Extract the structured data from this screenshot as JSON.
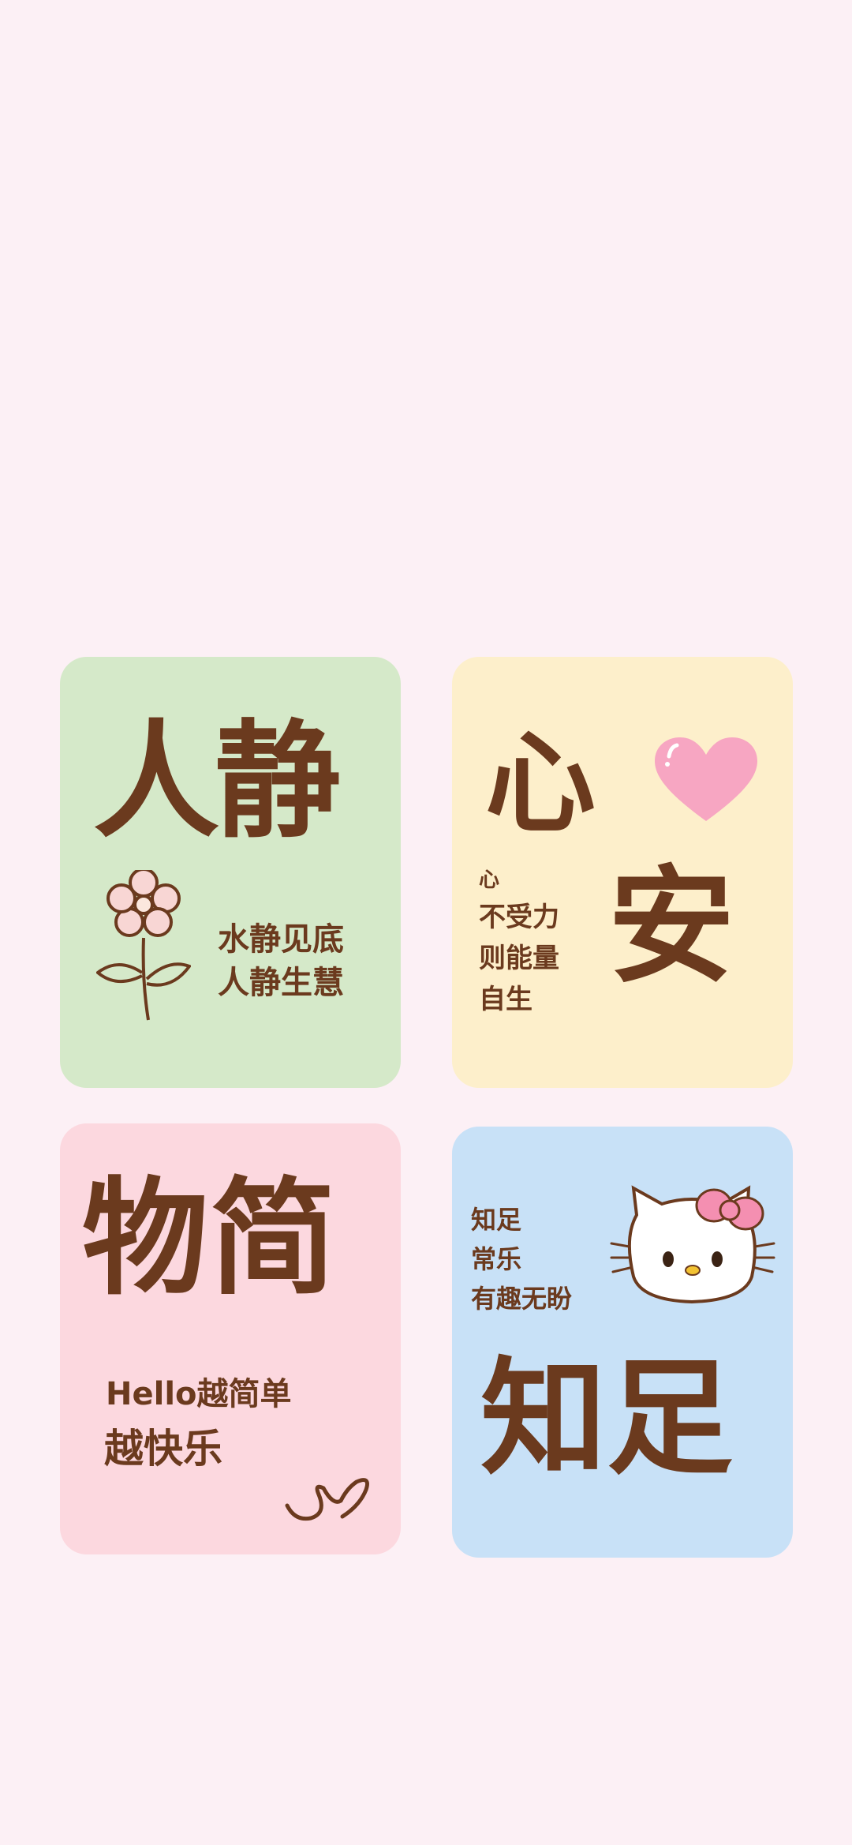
{
  "card1": {
    "title": "人静",
    "line1": "水静见底",
    "line2": "人静生慧"
  },
  "card2": {
    "title_top": "心",
    "title_bottom": "安",
    "line1": "心",
    "line2": "不受力",
    "line3": "则能量",
    "line4": "自生"
  },
  "card3": {
    "title": "物简",
    "line1": "Hello越简单",
    "line2": "越快乐"
  },
  "card4": {
    "line1": "知足",
    "line2": "常乐",
    "line3": "有趣无盼",
    "title": "知足"
  },
  "colors": {
    "background": "#fcf0f5",
    "green": "#d5e9c9",
    "yellow": "#fdefcb",
    "pink": "#fcd8df",
    "blue": "#c8e1f7",
    "text": "#6b3a1e",
    "heart": "#f7a6c2"
  },
  "icons": [
    "flower-icon",
    "heart-icon",
    "squiggle-icon",
    "cat-face-icon"
  ]
}
